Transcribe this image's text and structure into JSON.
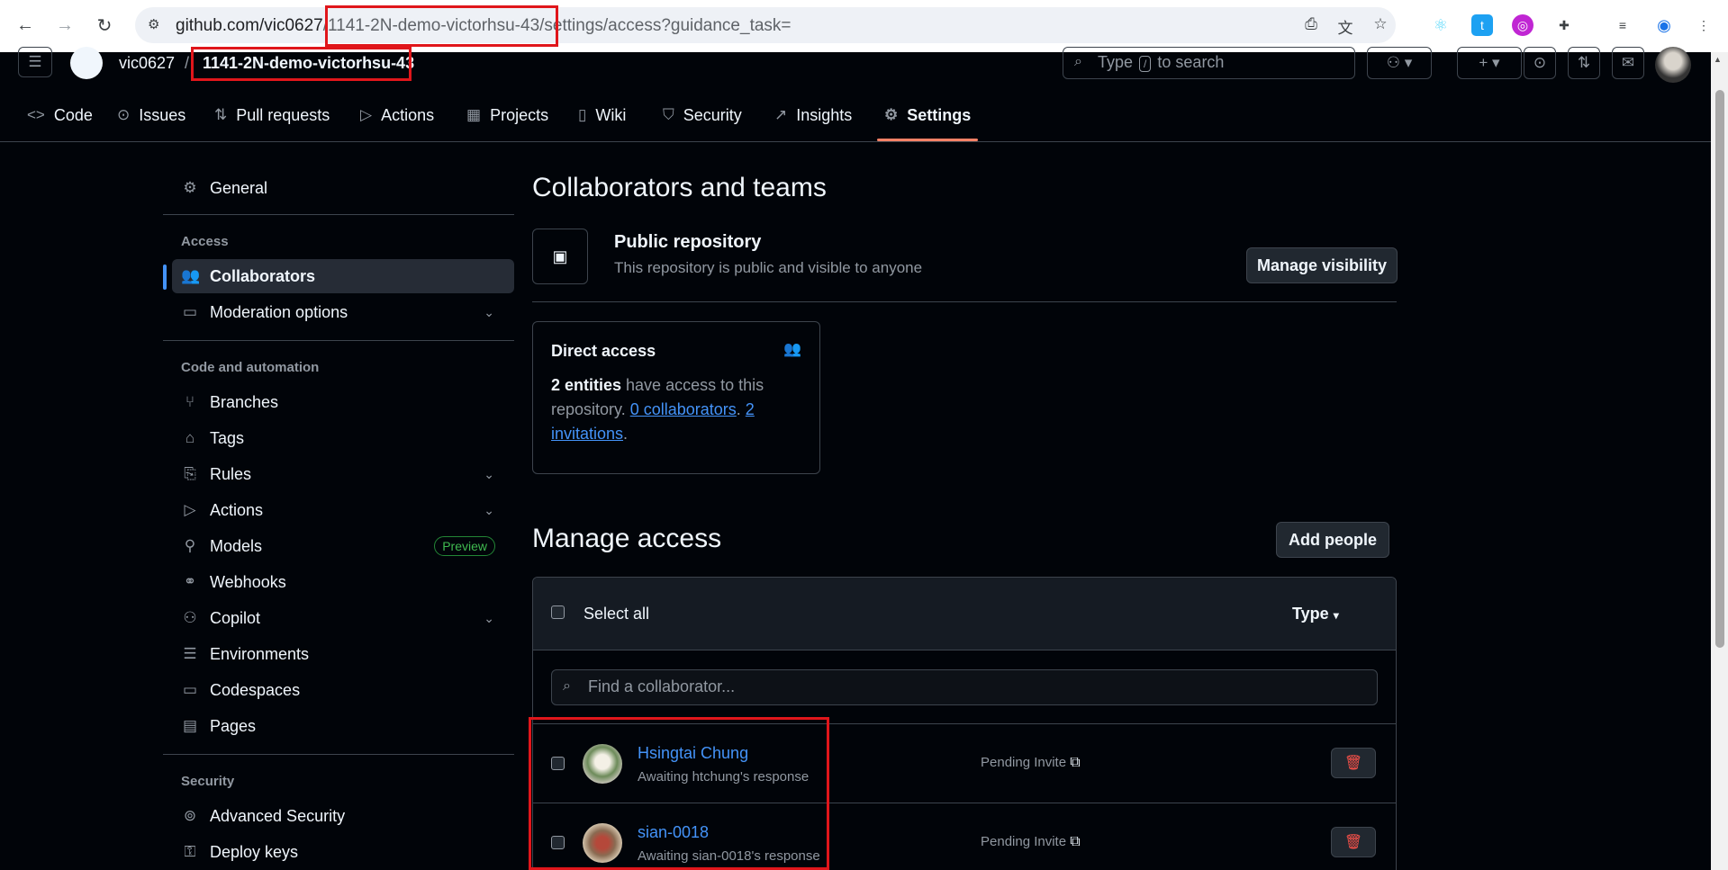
{
  "browser": {
    "url_prefix": "github.com/vic0627",
    "url_repo": "/1141-2N-demo-victorhsu-43/",
    "url_suffix": "settings/access?guidance_task="
  },
  "header": {
    "owner": "vic0627",
    "separator": "/",
    "repo": "1141-2N-demo-victorhsu-43",
    "search_type": "Type",
    "search_key": "/",
    "search_rest": "to search"
  },
  "tabs": [
    {
      "label": "Code",
      "icon": "code-icon"
    },
    {
      "label": "Issues",
      "icon": "issue-icon"
    },
    {
      "label": "Pull requests",
      "icon": "pull-request-icon"
    },
    {
      "label": "Actions",
      "icon": "play-icon"
    },
    {
      "label": "Projects",
      "icon": "table-icon"
    },
    {
      "label": "Wiki",
      "icon": "book-icon"
    },
    {
      "label": "Security",
      "icon": "shield-icon"
    },
    {
      "label": "Insights",
      "icon": "graph-icon"
    },
    {
      "label": "Settings",
      "icon": "gear-icon"
    }
  ],
  "sidebar": {
    "general": "General",
    "access_heading": "Access",
    "collaborators": "Collaborators",
    "moderation": "Moderation options",
    "code_heading": "Code and automation",
    "branches": "Branches",
    "tags": "Tags",
    "rules": "Rules",
    "actions": "Actions",
    "models": "Models",
    "preview": "Preview",
    "webhooks": "Webhooks",
    "copilot": "Copilot",
    "environments": "Environments",
    "codespaces": "Codespaces",
    "pages": "Pages",
    "security_heading": "Security",
    "advanced_security": "Advanced Security",
    "deploy_keys": "Deploy keys"
  },
  "main": {
    "title": "Collaborators and teams",
    "visibility_title": "Public repository",
    "visibility_desc": "This repository is public and visible to anyone",
    "manage_visibility": "Manage visibility",
    "direct_access_title": "Direct access",
    "entities": "2 entities",
    "entities_rest1": " have access to this repository. ",
    "collaborators_link": "0 collaborators",
    "dot": ". ",
    "invitations_link": "2 invitations",
    "period": ".",
    "manage_access": "Manage access",
    "add_people": "Add people",
    "select_all": "Select all",
    "type_filter": "Type",
    "find_placeholder": "Find a collaborator...",
    "rows": [
      {
        "name": "Hsingtai Chung",
        "sub": "Awaiting htchung's response",
        "status": "Pending Invite"
      },
      {
        "name": "sian-0018",
        "sub": "Awaiting sian-0018's response",
        "status": "Pending Invite"
      }
    ]
  }
}
